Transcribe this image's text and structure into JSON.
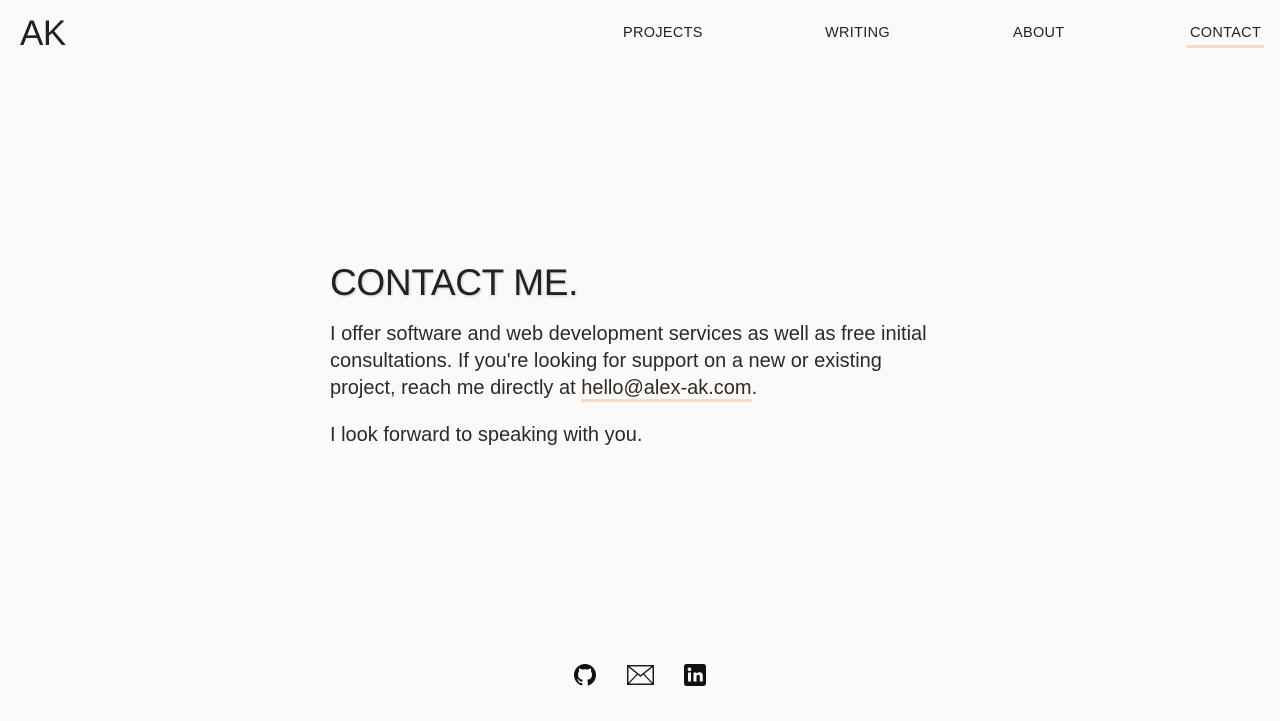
{
  "header": {
    "logo": "AK",
    "nav": {
      "projects": "PROJECTS",
      "writing": "WRITING",
      "about": "ABOUT",
      "contact": "CONTACT"
    },
    "active_item": "contact"
  },
  "main": {
    "heading": "CONTACT ME.",
    "paragraph1_text": "I offer software and web development services as well as free initial consultations. If you're looking for support on a new or existing project, reach me directly at ",
    "email": "hello@alex-ak.com",
    "paragraph1_end": ".",
    "paragraph2": "I look forward to speaking with you."
  },
  "footer": {
    "icons": [
      "github-icon",
      "mail-icon",
      "linkedin-icon"
    ]
  },
  "colors": {
    "background": "#fbfaf8",
    "text": "#222222",
    "accent_underline": "#f5dcc8"
  }
}
